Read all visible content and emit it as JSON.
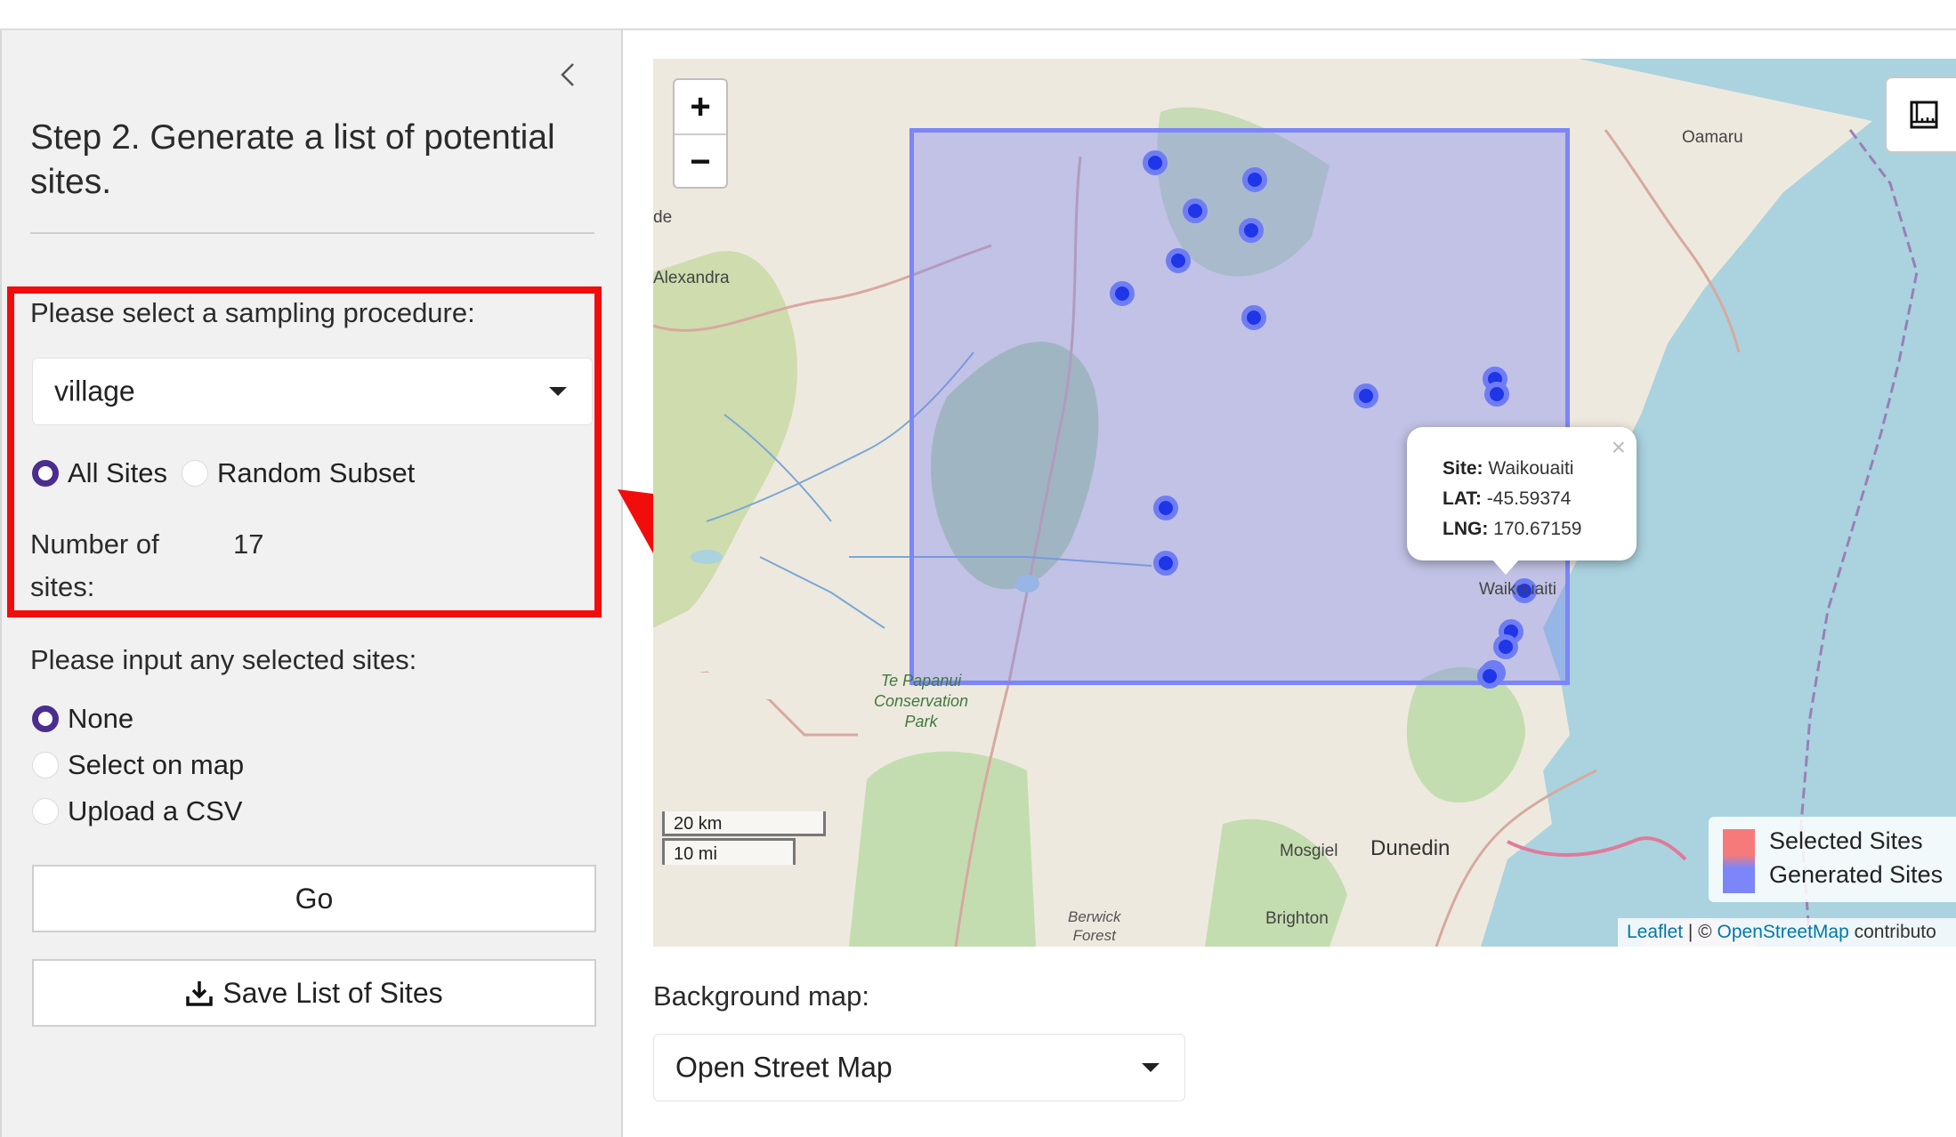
{
  "sidebar": {
    "step_title": "Step 2. Generate a list of potential sites.",
    "sampling_label": "Please select a sampling procedure:",
    "sampling_value": "village",
    "site_mode_options": [
      {
        "label": "All Sites",
        "selected": true
      },
      {
        "label": "Random Subset",
        "selected": false
      }
    ],
    "num_sites_label_line1": "Number of",
    "num_sites_label_line2": "sites:",
    "num_sites_value": "17",
    "selected_sites_label": "Please input any selected sites:",
    "selected_sites_options": [
      {
        "label": "None",
        "selected": true
      },
      {
        "label": "Select on map",
        "selected": false
      },
      {
        "label": "Upload a CSV",
        "selected": false
      }
    ],
    "go_button": "Go",
    "save_button": "Save List of Sites"
  },
  "map": {
    "zoom_in": "+",
    "zoom_out": "−",
    "place_labels": {
      "oamaru": "Oamaru",
      "alexandra": "Alexandra",
      "ide": "de",
      "te_papanui_1": "Te Papanui",
      "te_papanui_2": "Conservation",
      "te_papanui_3": "Park",
      "mosgiel": "Mosgiel",
      "dunedin": "Dunedin",
      "brighton": "Brighton",
      "berwick_1": "Berwick",
      "berwick_2": "Forest",
      "waikouaiti": "Waikouaiti"
    },
    "popup": {
      "site_key": "Site:",
      "site_value": "Waikouaiti",
      "lat_key": "LAT:",
      "lat_value": "-45.59374",
      "lng_key": "LNG:",
      "lng_value": "170.67159",
      "close": "×"
    },
    "scale_km": "20 km",
    "scale_mi": "10 mi",
    "legend": {
      "selected": "Selected Sites",
      "generated": "Generated Sites",
      "selected_color": "#f77a7a",
      "generated_color": "#7c86f8"
    },
    "attribution": {
      "leaflet": "Leaflet",
      "sep": " | © ",
      "osm": "OpenStreetMap",
      "rest": " contributo"
    }
  },
  "background_map": {
    "label": "Background map:",
    "value": "Open Street Map"
  },
  "colors": {
    "accent_radio": "#4b2d8f",
    "annotation_red": "#f20d0d",
    "site_marker": "#1f35e8",
    "sea": "#aad3df"
  }
}
